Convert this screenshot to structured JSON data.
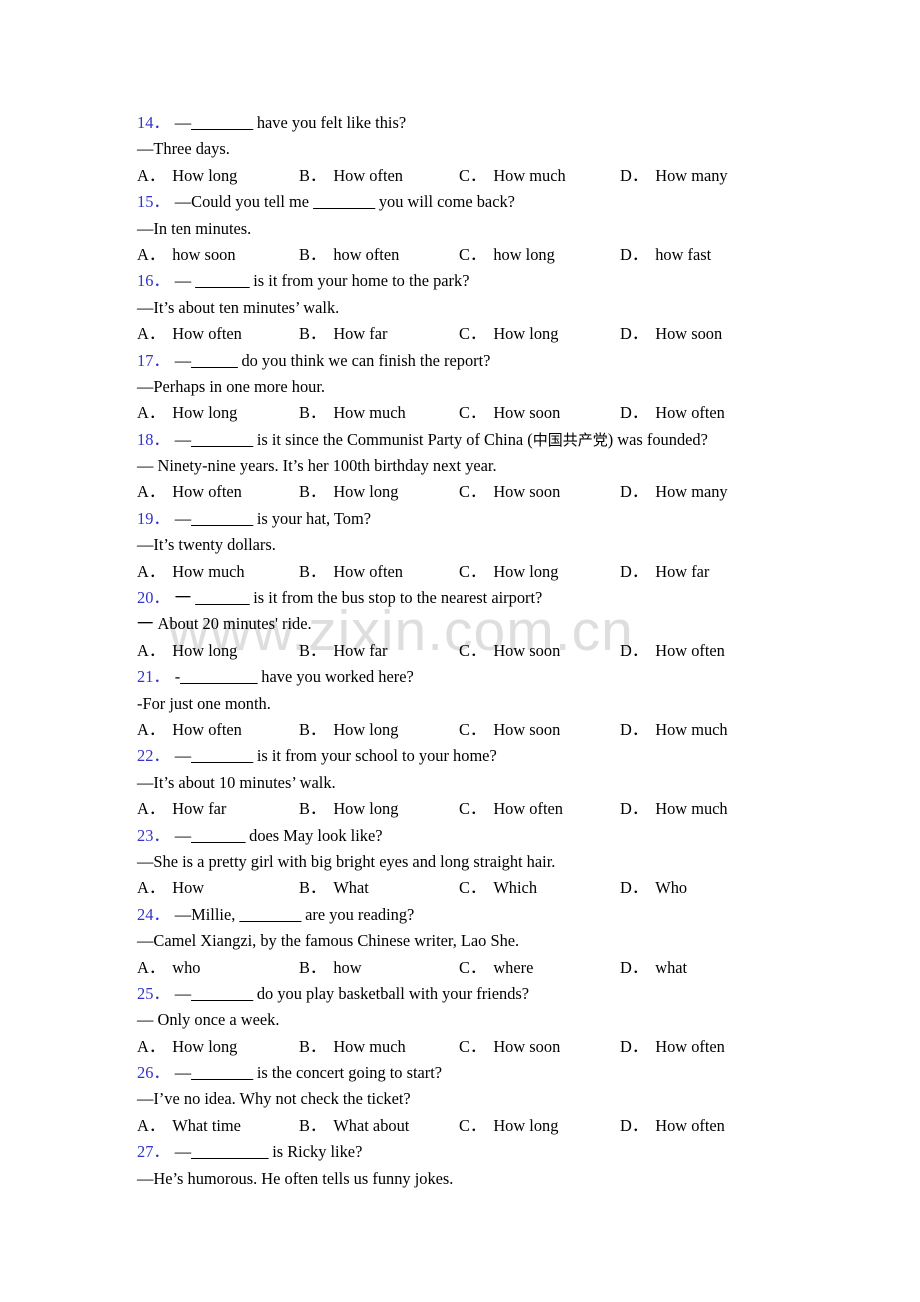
{
  "watermark": {
    "text": "www.zixin.com.cn"
  },
  "option_labels": [
    "A．",
    "B．",
    "C．",
    "D．"
  ],
  "questions": [
    {
      "number": "14．",
      "stem_prefix": "—",
      "blank": "________",
      "stem_suffix": " have you felt like this?",
      "answer": "—Three days.",
      "options": [
        "How long",
        "How often",
        "How much",
        "How many"
      ]
    },
    {
      "number": "15．",
      "stem_prefix": "—Could you tell me ",
      "blank": "________",
      "stem_suffix": " you will come back?",
      "answer": "—In ten minutes.",
      "options": [
        "how soon",
        "how often",
        "how long",
        "how fast"
      ]
    },
    {
      "number": "16．",
      "stem_prefix": "— ",
      "blank": "_______",
      "stem_suffix": " is it from your home to the park?",
      "answer": "—It’s about ten minutes’ walk.",
      "options": [
        "How often",
        "How far",
        "How long",
        "How soon"
      ]
    },
    {
      "number": "17．",
      "stem_prefix": "—",
      "blank": "______",
      "stem_suffix": " do you think we can finish the report?",
      "answer": "—Perhaps in one more hour.",
      "options": [
        "How long",
        "How much",
        "How soon",
        "How often"
      ]
    },
    {
      "number": "18．",
      "stem_prefix": "—",
      "blank": "________",
      "stem_suffix": " is it since the Communist Party of China (中国共产党) was founded?",
      "answer": "— Ninety-nine years. It’s her 100th birthday next year.",
      "options": [
        "How often",
        "How long",
        "How soon",
        "How many"
      ]
    },
    {
      "number": "19．",
      "stem_prefix": "—",
      "blank": "________",
      "stem_suffix": " is your hat, Tom?",
      "answer": "—It’s twenty dollars.",
      "options": [
        "How much",
        "How often",
        "How long",
        "How far"
      ]
    },
    {
      "number": "20．",
      "stem_prefix": "一 ",
      "blank": "_______",
      "stem_suffix": " is it from the bus stop to the nearest airport?",
      "answer": "一 About 20 minutes' ride.",
      "options": [
        "How long",
        "How far",
        "How soon",
        "How often"
      ]
    },
    {
      "number": "21．",
      "stem_prefix": "-",
      "blank": "__________",
      "stem_suffix": " have you worked here?",
      "answer": "-For just one month.",
      "options": [
        "How often",
        "How long",
        "How soon",
        "How much"
      ]
    },
    {
      "number": "22．",
      "stem_prefix": "—",
      "blank": "________",
      "stem_suffix": " is it from your school to your home?",
      "answer": "—It’s about 10 minutes’ walk.",
      "options": [
        "How far",
        "How long",
        "How often",
        "How much"
      ]
    },
    {
      "number": "23．",
      "stem_prefix": "—",
      "blank": "_______",
      "stem_suffix": " does May look like?",
      "answer": "—She is a pretty girl with big bright eyes and long straight hair.",
      "options": [
        "How",
        "What",
        "Which",
        "Who"
      ]
    },
    {
      "number": "24．",
      "stem_prefix": "—Millie, ",
      "blank": "________",
      "stem_suffix": " are you reading?",
      "answer": "—Camel Xiangzi, by the famous Chinese writer, Lao She.",
      "options": [
        "who",
        "how",
        "where",
        "what"
      ]
    },
    {
      "number": "25．",
      "stem_prefix": "—",
      "blank": "________",
      "stem_suffix": " do you play basketball with your friends?",
      "answer": "— Only once a week.",
      "options": [
        "How long",
        "How much",
        "How soon",
        "How often"
      ]
    },
    {
      "number": "26．",
      "stem_prefix": "—",
      "blank": "________",
      "stem_suffix": " is the concert going to start?",
      "answer": "—I’ve no idea. Why not check the ticket?",
      "options": [
        "What time",
        "What about",
        "How long",
        "How often"
      ]
    },
    {
      "number": "27．",
      "stem_prefix": "—",
      "blank": "__________",
      "stem_suffix": " is Ricky like?",
      "answer": "—He’s humorous. He often tells us funny jokes.",
      "options": [
        "",
        "",
        "",
        ""
      ]
    }
  ]
}
